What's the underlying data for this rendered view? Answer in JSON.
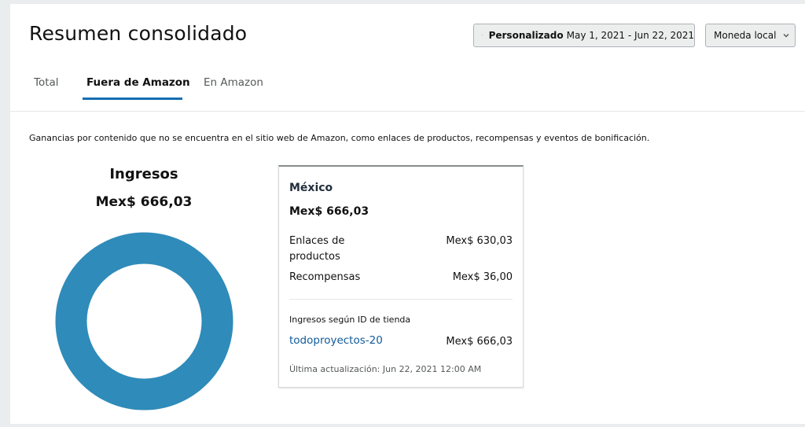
{
  "header": {
    "title": "Resumen consolidado",
    "date_button": {
      "icon": "calendar-icon",
      "bold_label": "Personalizado",
      "range": "May 1, 2021 - Jun 22, 2021"
    },
    "currency_button": {
      "label": "Moneda local",
      "icon": "chevron-down-icon"
    }
  },
  "tabs": [
    {
      "label": "Total",
      "active": false
    },
    {
      "label": "Fuera de Amazon",
      "active": true
    },
    {
      "label": "En Amazon",
      "active": false
    }
  ],
  "description": "Ganancias por contenido que no se encuentra en el sitio web de Amazon, como enlaces de productos, recompensas y eventos de bonificación.",
  "revenue": {
    "label": "Ingresos",
    "value": "Mex$ 666,03"
  },
  "chart_data": {
    "type": "pie",
    "donut": true,
    "categories": [
      "México"
    ],
    "values": [
      100
    ],
    "colors": [
      "#2f8bb9"
    ]
  },
  "card": {
    "country": "México",
    "total": "Mex$ 666,03",
    "rows": [
      {
        "label": "Enlaces de productos",
        "value": "Mex$ 630,03"
      },
      {
        "label": "Recompensas",
        "value": "Mex$ 36,00"
      }
    ],
    "store_heading": "Ingresos según ID de tienda",
    "store_id": "todoproyectos-20",
    "store_value": "Mex$ 666,03",
    "updated": "Última actualización: Jun 22, 2021 12:00 AM"
  },
  "colors": {
    "accent": "#146eb4",
    "link": "#0f5a99",
    "donut": "#2f8bb9"
  }
}
